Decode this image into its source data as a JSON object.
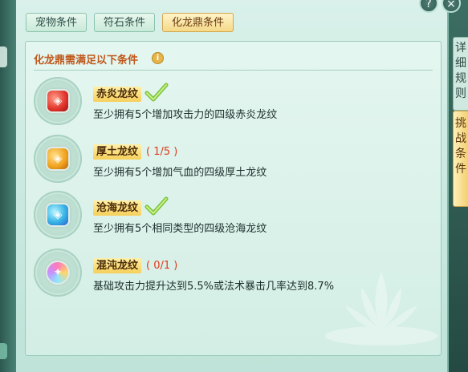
{
  "tabs": [
    {
      "label": "宠物条件",
      "active": false
    },
    {
      "label": "符石条件",
      "active": false
    },
    {
      "label": "化龙鼎条件",
      "active": true
    }
  ],
  "header": {
    "title": "化龙鼎需满足以下条件",
    "info_icon": "info-icon"
  },
  "conditions": [
    {
      "name": "赤炎龙纹",
      "progress": "",
      "status": "complete",
      "icon": "red-gem-icon",
      "description": "至少拥有5个增加攻击力的四级赤炎龙纹"
    },
    {
      "name": "厚土龙纹",
      "progress": "( 1/5 )",
      "status": "incomplete",
      "icon": "gold-gem-icon",
      "description": "至少拥有5个增加气血的四级厚土龙纹"
    },
    {
      "name": "沧海龙纹",
      "progress": "",
      "status": "complete",
      "icon": "blue-gem-icon",
      "description": "至少拥有5个相同类型的四级沧海龙纹"
    },
    {
      "name": "混沌龙纹",
      "progress": "( 0/1 )",
      "status": "incomplete",
      "icon": "chaos-gem-icon",
      "description": "基础攻击力提升达到5.5%或法术暴击几率达到8.7%"
    }
  ],
  "side_tabs": [
    {
      "label": "详细规则",
      "active": false
    },
    {
      "label": "挑战条件",
      "active": true
    }
  ],
  "window_buttons": {
    "help": "?",
    "close": "×"
  },
  "colors": {
    "accent_title": "#c0571a",
    "progress_red": "#e03a1c",
    "check_green": "#7bc23a",
    "active_tab": "#f4d988"
  }
}
